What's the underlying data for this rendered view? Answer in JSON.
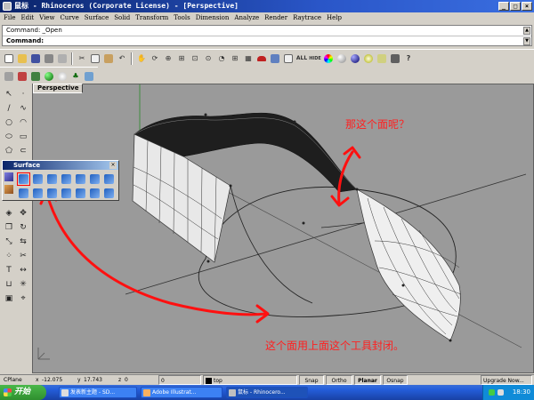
{
  "window": {
    "title": "鼠标 - Rhinoceros (Corporate License) - [Perspective]",
    "controls": [
      "_",
      "□",
      "×"
    ]
  },
  "menu": [
    "File",
    "Edit",
    "View",
    "Curve",
    "Surface",
    "Solid",
    "Transform",
    "Tools",
    "Dimension",
    "Analyze",
    "Render",
    "Raytrace",
    "Help"
  ],
  "command": {
    "history": "Command: _Open",
    "prompt": "Command:"
  },
  "viewport": {
    "tab_label": "Perspective",
    "background_color": "#9a9a9a"
  },
  "surface_toolbar": {
    "title": "Surface",
    "buttons": [
      "surface-from-corners",
      "surface-from-edges",
      "extrude",
      "loft",
      "patch",
      "sweep-1",
      "sweep-2",
      "revolve",
      "rail-revolve",
      "network",
      "planar",
      "edge-srf",
      "blend",
      "drape"
    ]
  },
  "annotations": {
    "question": "那这个面呢？",
    "explanation": "这个面用上面这个工具封闭。",
    "color": "#ff2020"
  },
  "statusbar": {
    "cplane": "CPlane",
    "x_label": "x",
    "x_value": "-12.075",
    "y_label": "y",
    "y_value": "17.743",
    "z_label": "z",
    "z_value": "0",
    "field4": "0",
    "layer": "top",
    "toggles": [
      "Snap",
      "Ortho",
      "Planar",
      "Osnap"
    ],
    "upgrade": "Upgrade Now..."
  },
  "taskbar": {
    "start": "开始",
    "tasks": [
      "发表新主题 - SD...",
      "Adobe Illustrat...",
      "鼠标 - Rhinocero..."
    ],
    "clock": "18:30"
  }
}
